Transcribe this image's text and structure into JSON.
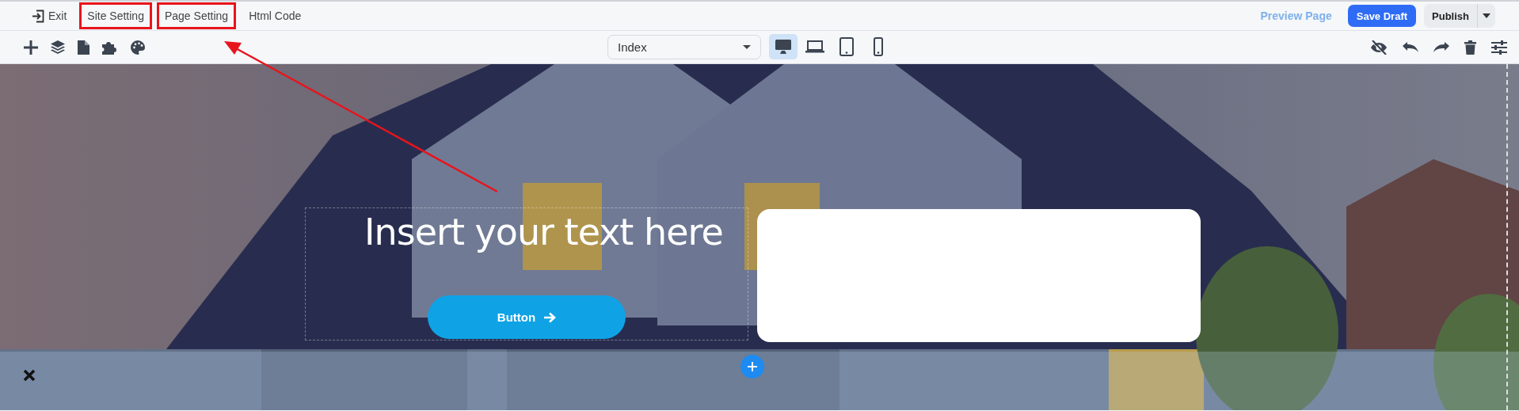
{
  "top_menu": [
    {
      "label": "Exit",
      "kind": "exit",
      "highlighted": false
    },
    {
      "label": "Site Setting",
      "kind": "link",
      "highlighted": true
    },
    {
      "label": "Page Setting",
      "kind": "link",
      "highlighted": true
    },
    {
      "label": "Html Code",
      "kind": "link",
      "highlighted": false
    }
  ],
  "actions": {
    "preview": "Preview Page",
    "save": "Save Draft",
    "publish": "Publish"
  },
  "toolbar": {
    "page_select": "Index",
    "devices": [
      {
        "kind": "desktop",
        "selected": true
      },
      {
        "kind": "laptop",
        "selected": false
      },
      {
        "kind": "tablet",
        "selected": false
      },
      {
        "kind": "phone",
        "selected": false
      }
    ]
  },
  "canvas": {
    "heading": "Insert your text here",
    "button": "Button"
  },
  "annotation": {
    "arrow": true
  }
}
